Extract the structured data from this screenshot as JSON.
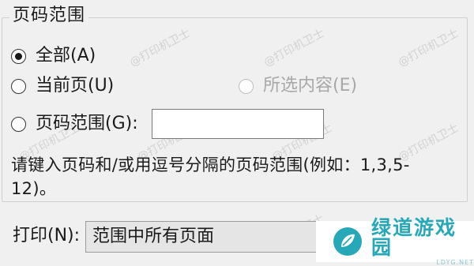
{
  "page_range": {
    "title": "页码范围",
    "options": {
      "all": {
        "label": "全部(A)",
        "checked": true,
        "enabled": true
      },
      "current_page": {
        "label": "当前页(U)",
        "checked": false,
        "enabled": true
      },
      "selection": {
        "label": "所选内容(E)",
        "checked": false,
        "enabled": false
      },
      "pages": {
        "label": "页码范围(G):",
        "checked": false,
        "enabled": true
      }
    },
    "pages_input": {
      "value": "",
      "placeholder": ""
    },
    "hint": "请键入页码和/或用逗号分隔的页码范围(例如：1,3,5-12)。"
  },
  "print": {
    "label": "打印(N):",
    "selected": "范围中所有页面"
  },
  "watermark": "@打印机卫士",
  "brand": {
    "name": "绿道游戏园",
    "sub": "LDYG.NET",
    "color": "#27a8b9"
  }
}
